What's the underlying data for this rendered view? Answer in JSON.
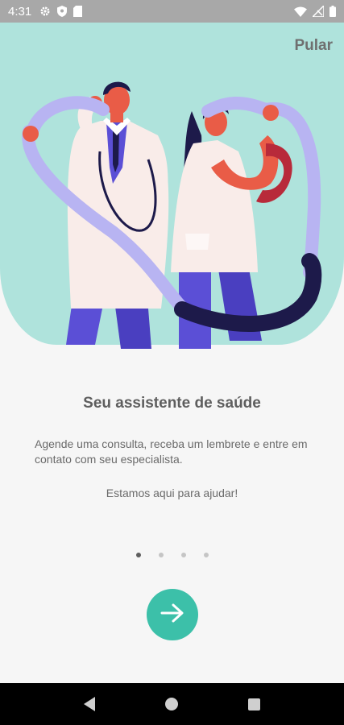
{
  "status_bar": {
    "time": "4:31",
    "left_icons": [
      "gear-icon",
      "shield-icon",
      "sim-card-icon"
    ],
    "right_icons": [
      "wifi-icon",
      "signal-off-icon",
      "battery-icon"
    ]
  },
  "onboarding": {
    "skip_label": "Pular",
    "title": "Seu assistente de saúde",
    "description": "Agende uma consulta, receba um lembrete e entre em contato com seu especialista.",
    "tagline": "Estamos aqui para ajudar!",
    "page_count": 4,
    "current_page": 1,
    "next_icon": "arrow-right-icon"
  },
  "colors": {
    "hero_background": "#afe3dc",
    "accent": "#3cc0a9",
    "coat": "#f9ece9",
    "pants": "#5b4fd6",
    "stethoscope": "#b8b4f2",
    "status_bar": "#a8a8a8"
  },
  "nav_bar": {
    "buttons": [
      "back-icon",
      "home-icon",
      "recents-icon"
    ]
  }
}
